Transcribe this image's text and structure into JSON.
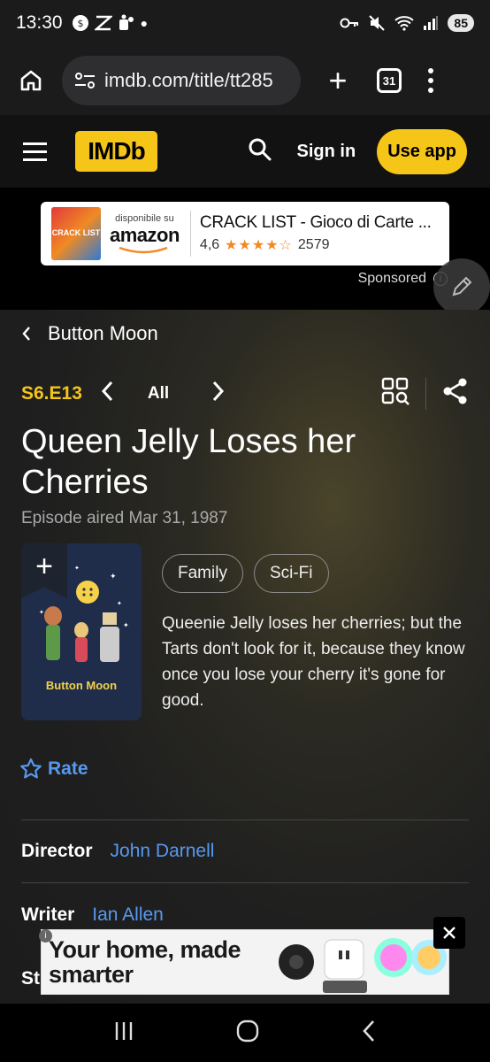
{
  "status": {
    "time": "13:30",
    "battery": "85"
  },
  "browser": {
    "url": "imdb.com/title/tt285",
    "tab_count": "31"
  },
  "header": {
    "logo": "IMDb",
    "sign_in": "Sign in",
    "use_app": "Use app"
  },
  "ad_top": {
    "product_label": "CRACK LIST",
    "available_on": "disponibile su",
    "store": "amazon",
    "title": "CRACK LIST - Gioco di Carte ...",
    "rating": "4,6",
    "stars": "★★★★☆",
    "reviews": "2579",
    "sponsored": "Sponsored"
  },
  "nav": {
    "back_label": "Button Moon"
  },
  "episode": {
    "code": "S6.E13",
    "all_label": "All",
    "title": "Queen Jelly Loses her Cherries",
    "aired": "Episode aired Mar 31, 1987",
    "poster_caption": "Button Moon",
    "genres": [
      "Family",
      "Sci-Fi"
    ],
    "description": "Queenie Jelly loses her cherries; but the Tarts don't look for it, because they know once you lose your cherry it's gone for good.",
    "rate_label": "Rate"
  },
  "credits": [
    {
      "label": "Director",
      "value": "John Darnell"
    },
    {
      "label": "Writer",
      "value": "Ian Allen"
    },
    {
      "label": "St",
      "value": ""
    }
  ],
  "ad_bottom": {
    "text": "Your home, made smarter"
  },
  "colors": {
    "imdb_yellow": "#f5c518",
    "link_blue": "#5799ef",
    "background": "#1c1c1c"
  }
}
